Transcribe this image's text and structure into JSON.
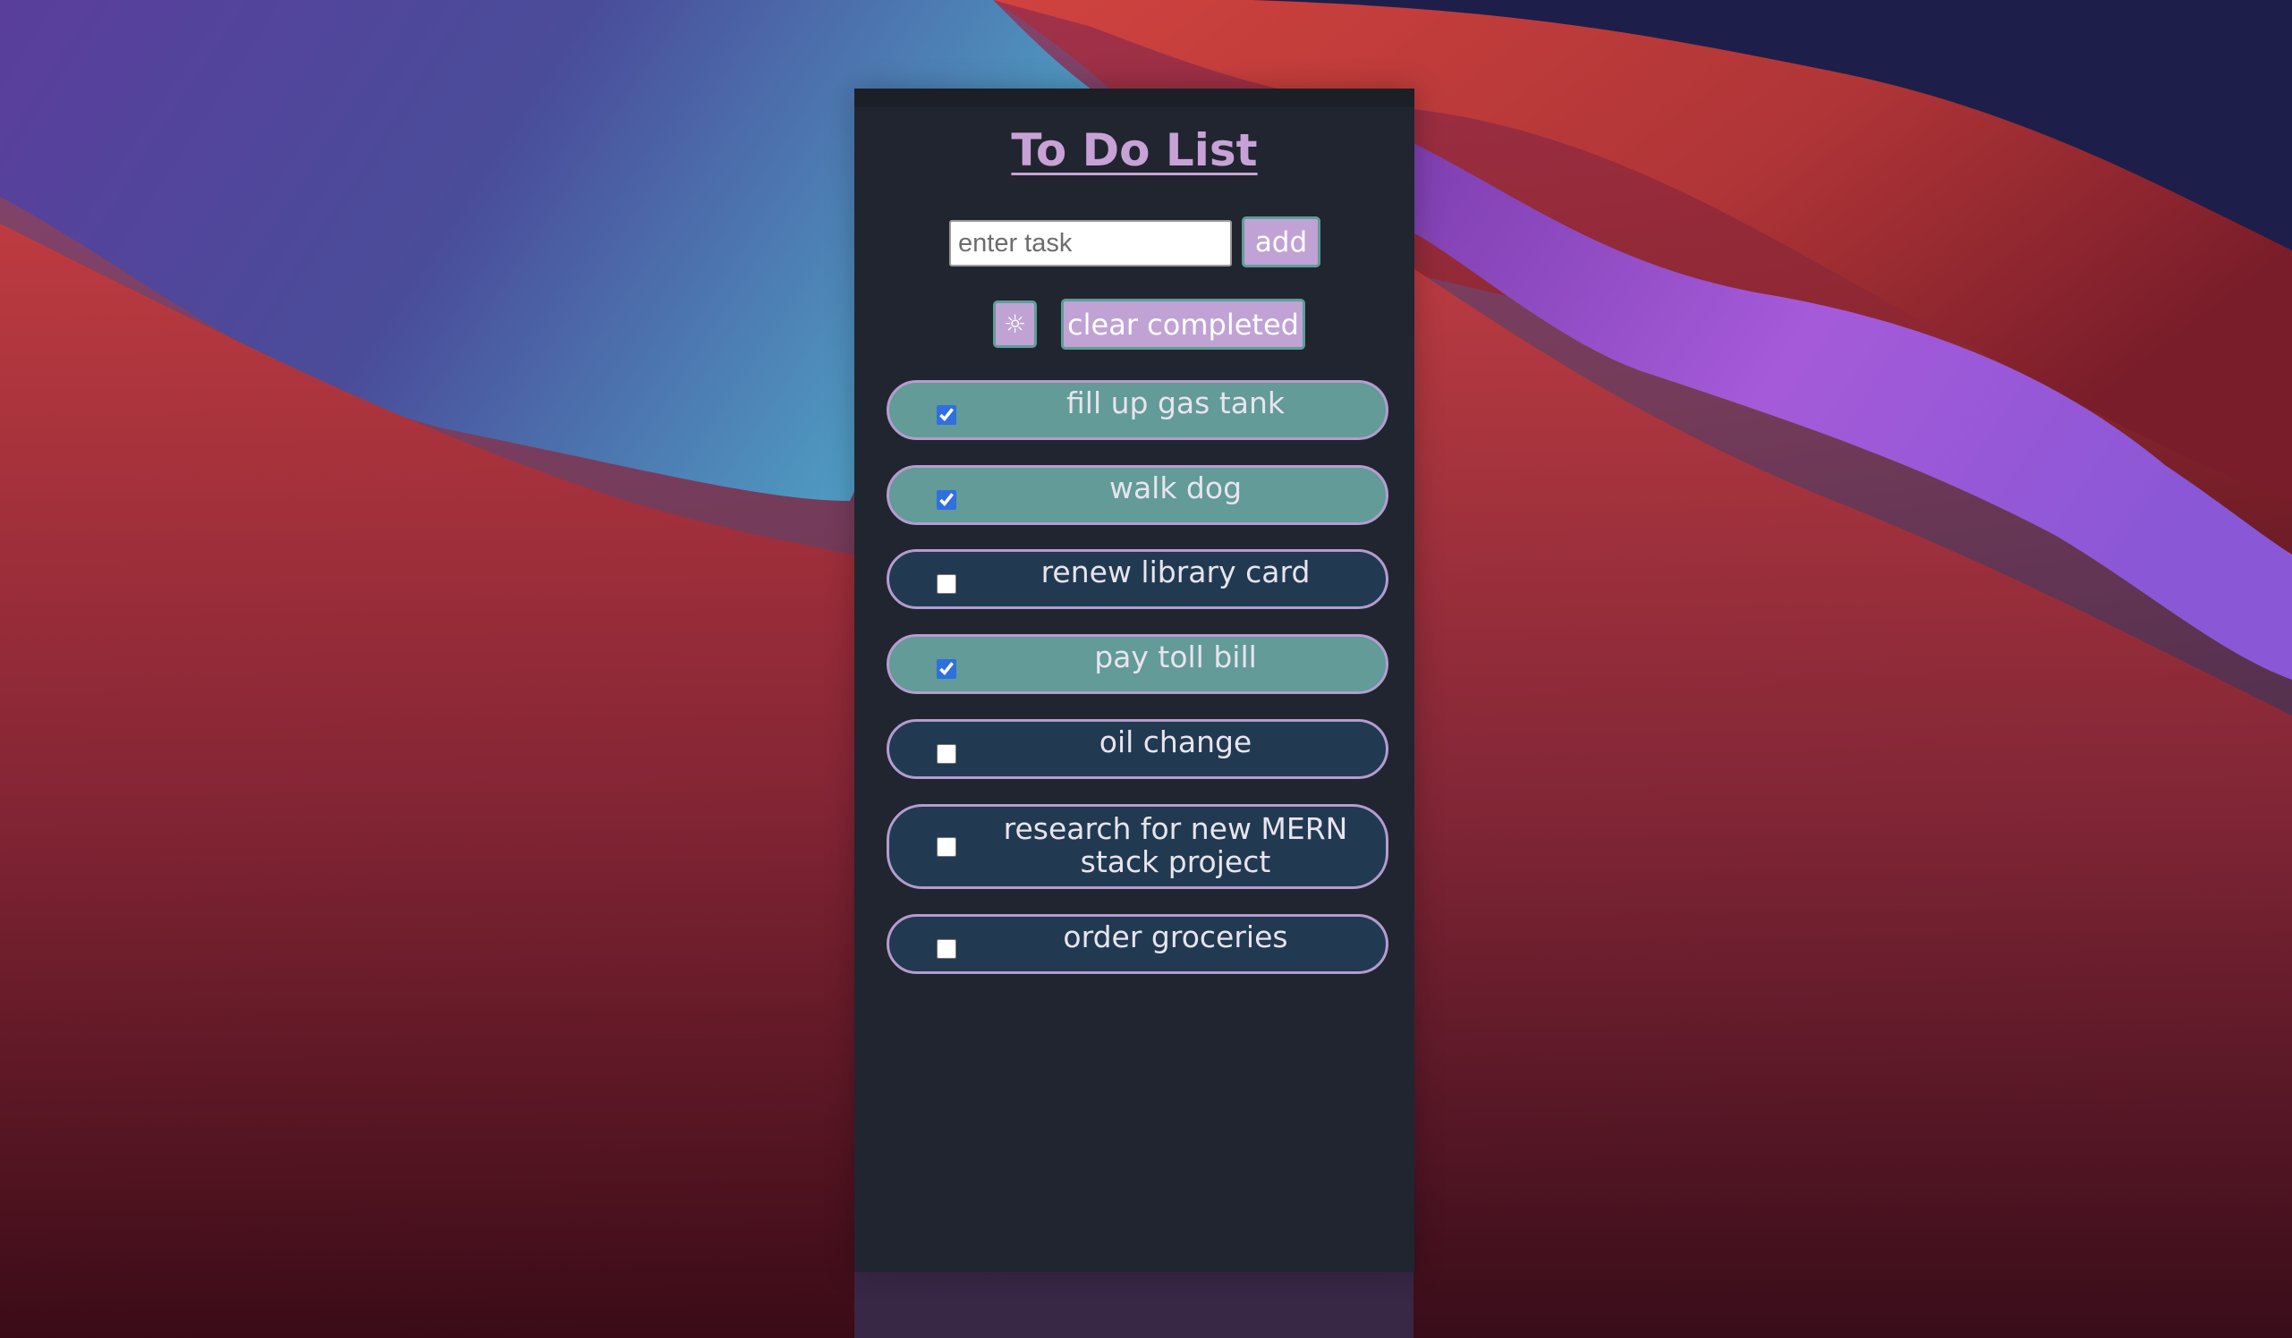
{
  "app": {
    "title": "To Do List",
    "input_placeholder": "enter task",
    "add_label": "add",
    "theme_icon_glyph": "☼",
    "theme_icon": "sun-icon",
    "clear_label": "clear completed"
  },
  "tasks": [
    {
      "text": "fill up gas tank",
      "completed": true
    },
    {
      "text": "walk dog",
      "completed": true
    },
    {
      "text": "renew library card",
      "completed": false
    },
    {
      "text": "pay toll bill",
      "completed": true
    },
    {
      "text": "oil change",
      "completed": false
    },
    {
      "text": "research for new MERN stack project",
      "completed": false
    },
    {
      "text": "order groceries",
      "completed": false
    }
  ],
  "colors": {
    "panel_bg": "#212530",
    "accent_purple": "#c0a3d4",
    "button_border_teal": "#5e9e98",
    "completed_item_bg": "#629b98",
    "open_item_bg": "#213a51",
    "item_border": "#b49ccf"
  }
}
